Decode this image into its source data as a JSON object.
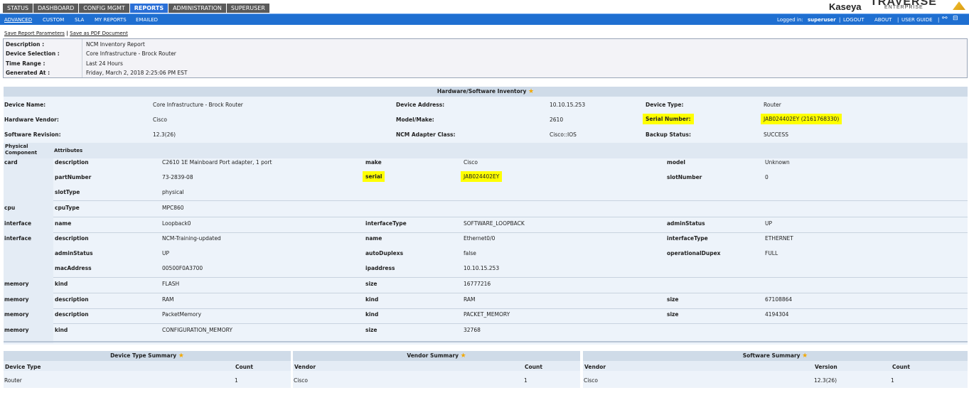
{
  "nav": {
    "tabs": [
      "STATUS",
      "DASHBOARD",
      "CONFIG MGMT",
      "REPORTS",
      "ADMINISTRATION",
      "SUPERUSER"
    ],
    "active_tab": "REPORTS",
    "subtabs": [
      "ADVANCED",
      "CUSTOM",
      "SLA",
      "MY REPORTS",
      "EMAILED"
    ],
    "active_subtab": "ADVANCED",
    "logged_in_label": "Logged in:",
    "user": "superuser",
    "logout": "LOGOUT",
    "about": "ABOUT",
    "user_guide": "USER GUIDE"
  },
  "brand": {
    "kaseya": "Kaseya",
    "traverse": "TRAVERSE",
    "enterprise": "ENTERPRISE"
  },
  "actions": {
    "save_params": "Save Report Parameters",
    "save_pdf": "Save as PDF Document"
  },
  "params": {
    "description_label": "Description :",
    "description": "NCM Inventory Report",
    "device_selection_label": "Device Selection :",
    "device_selection": "Core Infrastructure - Brock Router",
    "time_range_label": "Time Range :",
    "time_range": "Last 24 Hours",
    "generated_at_label": "Generated At :",
    "generated_at": "Friday, March 2, 2018 2:25:06 PM EST"
  },
  "inventory": {
    "title": "Hardware/Software Inventory",
    "device_name_label": "Device Name:",
    "device_name": "Core Infrastructure - Brock Router",
    "device_address_label": "Device Address:",
    "device_address": "10.10.15.253",
    "device_type_label": "Device Type:",
    "device_type": "Router",
    "hardware_vendor_label": "Hardware Vendor:",
    "hardware_vendor": "Cisco",
    "model_make_label": "Model/Make:",
    "model_make": "2610",
    "serial_number_label": "Serial Number:",
    "serial_number": "JAB024402EY (2161768330)",
    "software_revision_label": "Software Revision:",
    "software_revision": "12.3(26)",
    "ncm_adapter_label": "NCM Adapter Class:",
    "ncm_adapter": "Cisco::IOS",
    "backup_status_label": "Backup Status:",
    "backup_status": "SUCCESS",
    "physical_component_header": "Physical Component",
    "attributes_header": "Attributes"
  },
  "components": [
    {
      "name": "card",
      "lines": [
        [
          [
            "description",
            "C2610 1E Mainboard Port adapter, 1 port"
          ],
          [
            "make",
            "Cisco"
          ],
          [
            "model",
            "Unknown"
          ]
        ],
        [
          [
            "partNumber",
            "73-2839-08"
          ],
          [
            "serial",
            "JAB024402EY"
          ],
          [
            "slotNumber",
            "0"
          ]
        ],
        [
          [
            "slotType",
            "physical"
          ]
        ]
      ]
    },
    {
      "name": "cpu",
      "lines": [
        [
          [
            "cpuType",
            "MPC860"
          ]
        ]
      ]
    },
    {
      "name": "interface",
      "lines": [
        [
          [
            "name",
            "Loopback0"
          ],
          [
            "interfaceType",
            "SOFTWARE_LOOPBACK"
          ],
          [
            "adminStatus",
            "UP"
          ]
        ]
      ]
    },
    {
      "name": "interface",
      "lines": [
        [
          [
            "description",
            "NCM-Training-updated"
          ],
          [
            "name",
            "Ethernet0/0"
          ],
          [
            "interfaceType",
            "ETHERNET"
          ]
        ],
        [
          [
            "adminStatus",
            "UP"
          ],
          [
            "autoDuplexs",
            "false"
          ],
          [
            "operationalDupex",
            "FULL"
          ]
        ],
        [
          [
            "macAddress",
            "00500F0A3700"
          ],
          [
            "ipaddress",
            "10.10.15.253"
          ]
        ]
      ]
    },
    {
      "name": "memory",
      "lines": [
        [
          [
            "kind",
            "FLASH"
          ],
          [
            "size",
            "16777216"
          ]
        ]
      ]
    },
    {
      "name": "memory",
      "lines": [
        [
          [
            "description",
            "RAM"
          ],
          [
            "kind",
            "RAM"
          ],
          [
            "size",
            "67108864"
          ]
        ]
      ]
    },
    {
      "name": "memory",
      "lines": [
        [
          [
            "description",
            "PacketMemory"
          ],
          [
            "kind",
            "PACKET_MEMORY"
          ],
          [
            "size",
            "4194304"
          ]
        ]
      ]
    },
    {
      "name": "memory",
      "lines": [
        [
          [
            "kind",
            "CONFIGURATION_MEMORY"
          ],
          [
            "size",
            "32768"
          ]
        ]
      ]
    }
  ],
  "summaries": {
    "device_type": {
      "title": "Device Type Summary",
      "col1": "Device Type",
      "col2": "Count",
      "row": [
        "Router",
        "1"
      ]
    },
    "vendor": {
      "title": "Vendor Summary",
      "col1": "Vendor",
      "col2": "Count",
      "row": [
        "Cisco",
        "1"
      ]
    },
    "software": {
      "title": "Software Summary",
      "col1": "Vendor",
      "col2": "Version",
      "col3": "Count",
      "row": [
        "Cisco",
        "12.3(26)",
        "1"
      ]
    }
  },
  "colors": {
    "nav_blue": "#1f6fd1",
    "highlight": "#ffff00",
    "star": "#f2a800"
  }
}
